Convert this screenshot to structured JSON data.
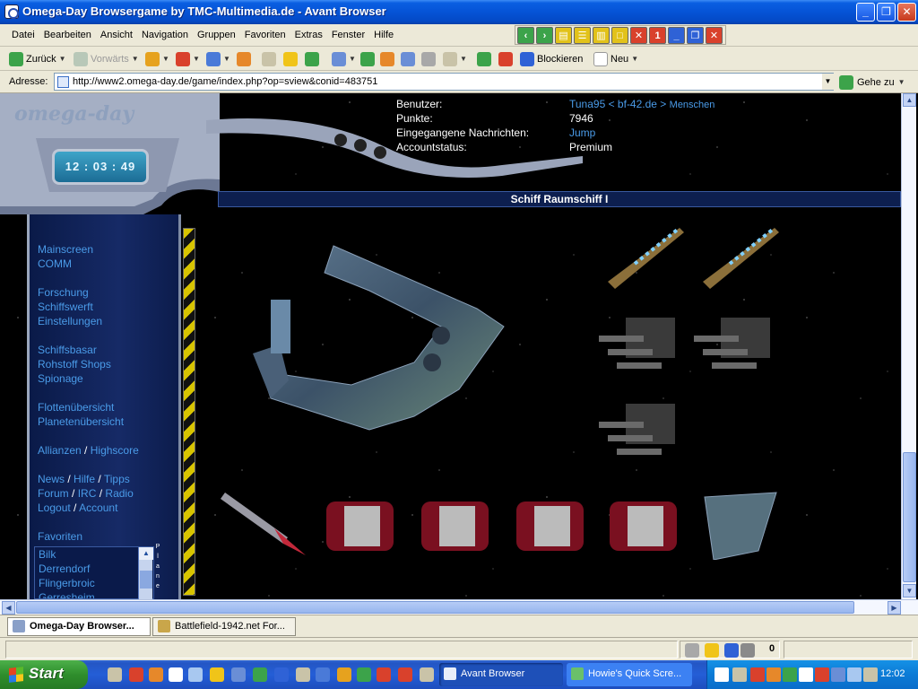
{
  "window": {
    "title": "Omega-Day Browsergame by TMC-Multimedia.de - Avant Browser"
  },
  "menu": [
    "Datei",
    "Bearbeiten",
    "Ansicht",
    "Navigation",
    "Gruppen",
    "Favoriten",
    "Extras",
    "Fenster",
    "Hilfe"
  ],
  "toolbar": {
    "back_label": "Zurück",
    "forward_label": "Vorwärts",
    "block_label": "Blockieren",
    "new_label": "Neu"
  },
  "address": {
    "label": "Adresse:",
    "url": "http://www2.omega-day.de/game/index.php?op=sview&conid=483751",
    "go_label": "Gehe zu"
  },
  "game": {
    "logo": "omega-day",
    "clock": "12 : 03 : 49",
    "nav": {
      "mainscreen": "Mainscreen",
      "comm": "COMM",
      "forschung": "Forschung",
      "schiffswerft": "Schiffswerft",
      "einstellungen": "Einstellungen",
      "schiffsbasar": "Schiffsbasar",
      "rohstoff_shops": "Rohstoff Shops",
      "spionage": "Spionage",
      "flottenuebersicht": "Flottenübersicht",
      "planetenuebersicht": "Planetenübersicht",
      "allianzen": "Allianzen",
      "highscore": "Highscore",
      "news": "News",
      "hilfe": "Hilfe",
      "tipps": "Tipps",
      "forum": "Forum",
      "irc": "IRC",
      "radio": "Radio",
      "logout": "Logout",
      "account": "Account",
      "sep": "/"
    },
    "favoriten_heading": "Favoriten",
    "favoriten": [
      "Bilk",
      "Derrendorf",
      "Flingerbroic",
      "Gerresheim"
    ],
    "planet_vertical": [
      "P",
      "l",
      "a",
      "n",
      "e"
    ],
    "user": {
      "benutzer_label": "Benutzer:",
      "benutzer_value": "Tuna95 < bf-42.de >",
      "benutzer_race": "Menschen",
      "punkte_label": "Punkte:",
      "punkte_value": "7946",
      "nachrichten_label": "Eingegangene Nachrichten:",
      "nachrichten_value": "Jump",
      "accountstatus_label": "Accountstatus:",
      "accountstatus_value": "Premium"
    },
    "ship_title": "Schiff Raumschiff I"
  },
  "tabs": [
    {
      "label": "Omega-Day Browser...",
      "active": true
    },
    {
      "label": "Battlefield-1942.net For...",
      "active": false
    }
  ],
  "status": {
    "count": "0"
  },
  "taskbar": {
    "start_label": "Start",
    "tasks": [
      "Avant Browser",
      "Howie's Quick Scre..."
    ],
    "time": "12:02"
  },
  "colors": {
    "link": "#4a9be8",
    "header_bg": "#0d1f4f",
    "title_bar": "#0553d6"
  }
}
